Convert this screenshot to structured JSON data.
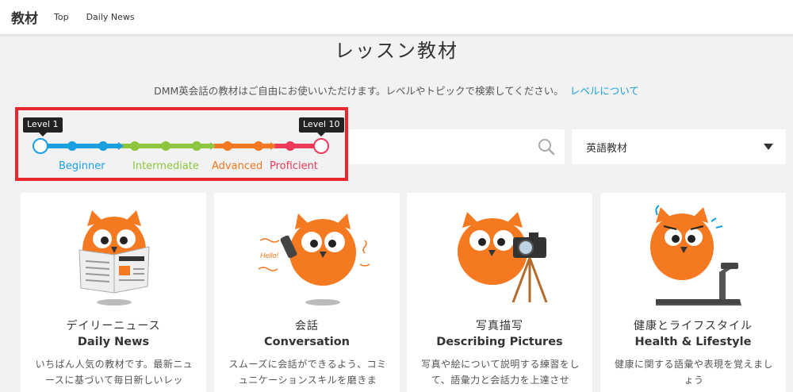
{
  "header": {
    "brand": "教材",
    "nav": [
      "Top",
      "Daily News"
    ]
  },
  "page_title": "レッスン教材",
  "intro": {
    "text": "DMM英会話の教材はご自由にお使いいただけます。レベルやトピックで検索してください。",
    "link": "レベルについて"
  },
  "level_filter": {
    "min_tooltip": "Level 1",
    "max_tooltip": "Level 10",
    "labels": [
      "Beginner",
      "Intermediate",
      "Advanced",
      "Proficient"
    ],
    "colors": {
      "beginner": "#1a9fe0",
      "intermediate": "#8cc63f",
      "advanced": "#f47920",
      "proficient": "#ee3a59",
      "highlight": "#e8262e"
    }
  },
  "search": {
    "placeholder": "",
    "icon": "search-icon"
  },
  "category_select": {
    "selected": "英語教材"
  },
  "cards": [
    {
      "jp": "デイリーニュース",
      "en": "Daily News",
      "desc": "いちばん人気の教材です。最新ニュースに基づいて毎日新しいレッ",
      "icon": "owl-newspaper-icon"
    },
    {
      "jp": "会話",
      "en": "Conversation",
      "desc": "スムーズに会話ができるよう、コミュニケーションスキルを磨きま",
      "icon": "owl-phone-icon"
    },
    {
      "jp": "写真描写",
      "en": "Describing Pictures",
      "desc": "写真や絵について説明する練習をして、語彙力と会話力を上達させ",
      "icon": "owl-camera-icon"
    },
    {
      "jp": "健康とライフスタイル",
      "en": "Health & Lifestyle",
      "desc": "健康に関する語彙や表現を覚えましょう",
      "icon": "owl-treadmill-icon"
    }
  ]
}
